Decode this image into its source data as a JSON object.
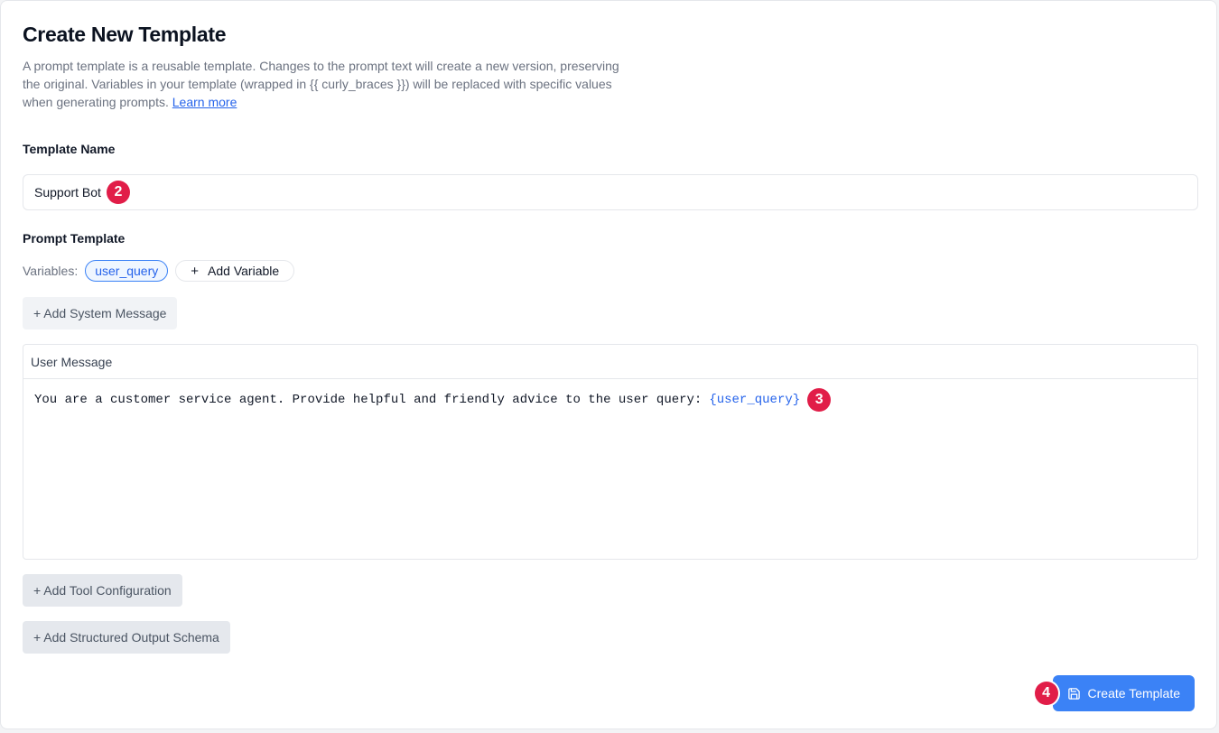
{
  "header": {
    "title": "Create New Template",
    "description": "A prompt template is a reusable template. Changes to the prompt text will create a new version, preserving the original. Variables in your template (wrapped in {{ curly_braces }}) will be replaced with specific values when generating prompts.",
    "learn_more": "Learn more"
  },
  "name_field": {
    "label": "Template Name",
    "value": "Support Bot",
    "marker": "2"
  },
  "prompt": {
    "label": "Prompt Template",
    "variables_label": "Variables:",
    "variables": [
      "user_query"
    ],
    "add_variable": "Add Variable",
    "add_system_message": "+ Add System Message",
    "user_message": {
      "header": "User Message",
      "text": "You are a customer service agent. Provide helpful and friendly advice to the user query:",
      "variable_text": "{user_query}",
      "marker": "3"
    }
  },
  "actions": {
    "add_tool": "+ Add Tool Configuration",
    "add_schema": "+ Add Structured Output Schema",
    "create": "Create Template",
    "create_marker": "4"
  },
  "colors": {
    "accent": "#3b82f6",
    "marker": "#e11d48"
  }
}
